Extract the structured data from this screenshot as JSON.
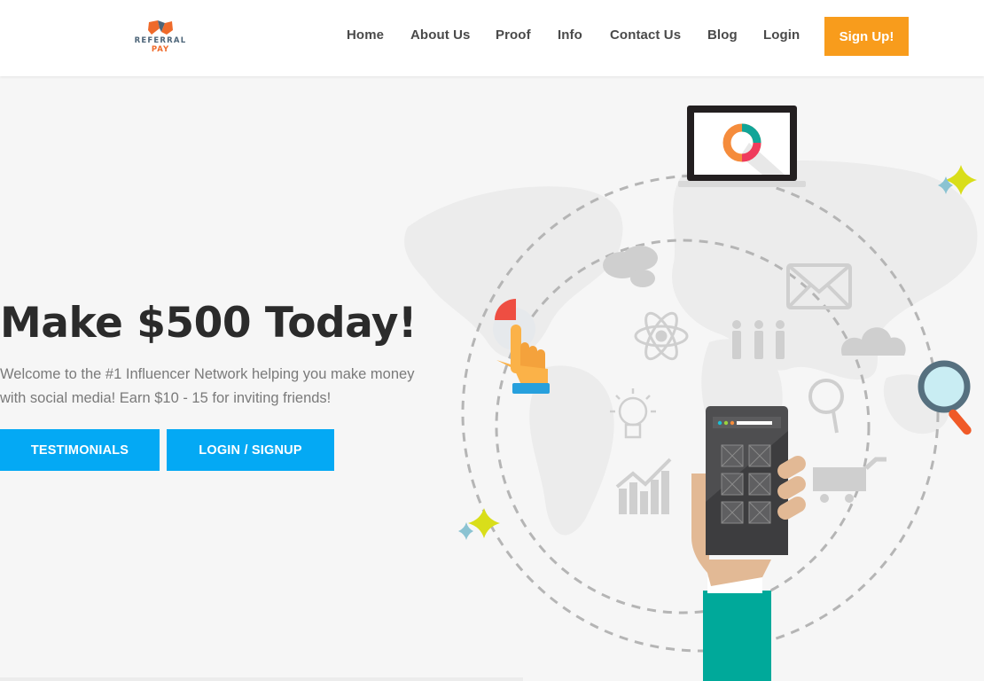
{
  "brand": {
    "name": "REFERRAL",
    "sub": "PAY",
    "colors": {
      "primary": "#4c6478",
      "accent": "#ef6a2a"
    }
  },
  "nav": {
    "items": [
      {
        "label": "Home"
      },
      {
        "label": "About Us"
      },
      {
        "label": "Proof"
      },
      {
        "label": "Info"
      },
      {
        "label": "Contact Us"
      },
      {
        "label": "Blog"
      },
      {
        "label": "Login"
      }
    ],
    "cta_label": "Sign Up!",
    "cta_color": "#f89c1c"
  },
  "hero": {
    "title": "Make $500 Today!",
    "description": "Welcome to the #1 Influencer Network helping you make money with social media! Earn $10 - 15 for inviting friends!",
    "buttons": [
      {
        "label": "TESTIMONIALS"
      },
      {
        "label": "LOGIN / SIGNUP"
      }
    ],
    "button_color": "#04a9f4"
  },
  "illustration": {
    "icons": [
      "laptop-donut-chart-icon",
      "sparkle-icon",
      "hand-pointer-icon",
      "chat-bubbles-icon",
      "atom-icon",
      "team-icon",
      "envelope-icon",
      "cloud-icon",
      "magnifier-icon",
      "lightbulb-icon",
      "growth-chart-icon",
      "search-icon",
      "shopping-cart-icon",
      "smartphone-hand-icon"
    ]
  }
}
